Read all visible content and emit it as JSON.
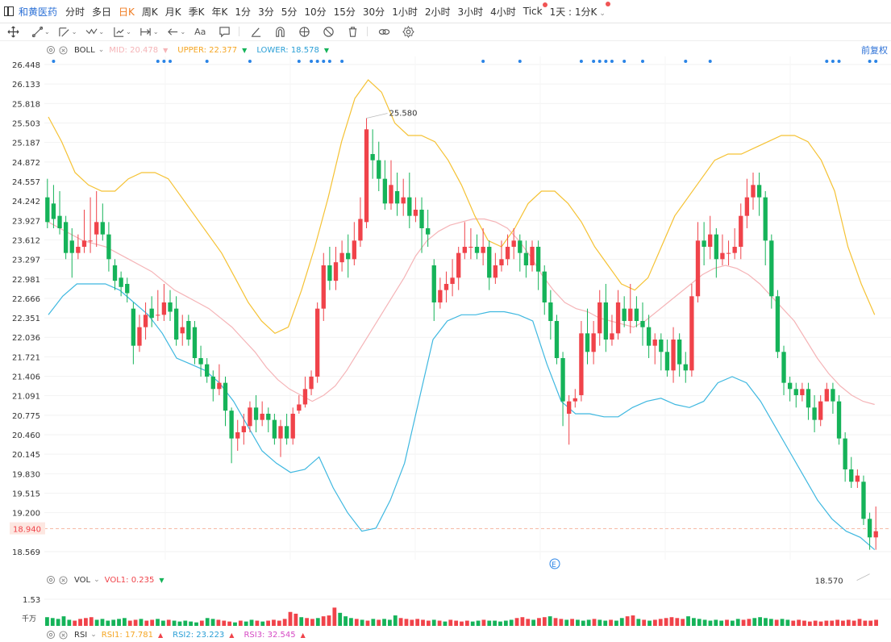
{
  "toolbar": {
    "stock_name": "和黄医药",
    "periods": [
      "分时",
      "多日",
      "日K",
      "周K",
      "月K",
      "季K",
      "年K",
      "1分",
      "3分",
      "5分",
      "10分",
      "15分",
      "30分",
      "1小时",
      "2小时",
      "3小时",
      "4小时",
      "Tick",
      "1天 : 1分K"
    ],
    "active_period": "日K"
  },
  "icons": [
    "move-icon",
    "line-icon",
    "channel-icon",
    "wave-icon",
    "measure-icon",
    "range-icon",
    "arrow-icon",
    "text-icon",
    "comment-icon",
    "pen-icon",
    "magnet-icon",
    "eye-icon",
    "hide-icon",
    "trash-icon",
    "link-icon",
    "gear-icon"
  ],
  "boll": {
    "name": "BOLL",
    "mid_label": "MID:",
    "mid": "20.478",
    "upper_label": "UPPER:",
    "upper": "22.377",
    "lower_label": "LOWER:",
    "lower": "18.578",
    "adjust": "前复权"
  },
  "vol": {
    "name": "VOL",
    "vol1_label": "VOL1:",
    "vol1": "0.235",
    "max": "1.53",
    "unit": "千万"
  },
  "rsi": {
    "name": "RSI",
    "rsi1_label": "RSI1:",
    "rsi1": "17.781",
    "rsi2_label": "RSI2:",
    "rsi2": "23.223",
    "rsi3_label": "RSI3:",
    "rsi3": "32.545"
  },
  "colors": {
    "up": "#f0434a",
    "down": "#15b359",
    "mid": "#f5b4b7",
    "upper": "#f5c234",
    "lower": "#3fb8e0",
    "accent": "#2a6fd6",
    "active": "#f07c22"
  },
  "chart_data": {
    "type": "candlestick",
    "y_ticks": [
      "26.448",
      "26.133",
      "25.818",
      "25.503",
      "25.187",
      "24.872",
      "24.557",
      "24.242",
      "23.927",
      "23.612",
      "23.297",
      "22.981",
      "22.666",
      "22.351",
      "22.036",
      "21.721",
      "21.406",
      "21.091",
      "20.775",
      "20.460",
      "20.145",
      "19.830",
      "19.515",
      "19.200",
      "18.569"
    ],
    "ylim": [
      18.569,
      26.448
    ],
    "current_price": "18.940",
    "high_label": "25.580",
    "low_label": "18.570",
    "candles": [
      [
        24.3,
        23.9,
        24.6,
        23.8
      ],
      [
        24.2,
        23.95,
        24.5,
        23.8
      ],
      [
        24.0,
        23.8,
        24.4,
        23.7
      ],
      [
        23.9,
        23.4,
        24.0,
        23.3
      ],
      [
        23.6,
        23.4,
        23.8,
        23.0
      ],
      [
        23.4,
        23.5,
        23.7,
        23.3
      ],
      [
        23.5,
        23.6,
        24.1,
        23.4
      ],
      [
        23.6,
        23.6,
        24.3,
        23.4
      ],
      [
        23.7,
        23.9,
        24.4,
        23.5
      ],
      [
        23.9,
        23.7,
        24.2,
        23.6
      ],
      [
        23.7,
        23.3,
        23.9,
        23.1
      ],
      [
        23.2,
        22.95,
        23.3,
        22.8
      ],
      [
        23.0,
        22.85,
        23.1,
        22.7
      ],
      [
        22.9,
        22.75,
        23.0,
        22.6
      ],
      [
        22.5,
        21.9,
        22.6,
        21.6
      ],
      [
        21.9,
        22.2,
        22.4,
        21.8
      ],
      [
        22.2,
        22.4,
        22.6,
        22.0
      ],
      [
        22.5,
        22.35,
        22.7,
        22.2
      ],
      [
        22.4,
        22.4,
        22.8,
        22.3
      ],
      [
        22.4,
        22.6,
        22.9,
        22.3
      ],
      [
        22.6,
        22.45,
        22.8,
        22.3
      ],
      [
        22.5,
        22.0,
        22.7,
        21.9
      ],
      [
        22.1,
        22.2,
        22.4,
        21.9
      ],
      [
        22.3,
        22.0,
        22.4,
        21.9
      ],
      [
        22.2,
        21.7,
        22.3,
        21.6
      ],
      [
        21.7,
        21.6,
        21.9,
        21.4
      ],
      [
        21.6,
        21.4,
        21.7,
        21.3
      ],
      [
        21.4,
        21.2,
        21.5,
        21.0
      ],
      [
        21.2,
        21.3,
        21.6,
        21.1
      ],
      [
        21.3,
        20.85,
        21.4,
        20.6
      ],
      [
        20.85,
        20.4,
        20.9,
        20.0
      ],
      [
        20.4,
        20.5,
        20.7,
        20.2
      ],
      [
        20.5,
        20.6,
        20.8,
        20.3
      ],
      [
        20.6,
        20.9,
        21.0,
        20.5
      ],
      [
        20.9,
        20.7,
        21.1,
        20.5
      ],
      [
        20.7,
        20.8,
        21.0,
        20.6
      ],
      [
        20.8,
        20.7,
        20.9,
        20.5
      ],
      [
        20.7,
        20.4,
        20.8,
        20.3
      ],
      [
        20.4,
        20.6,
        20.7,
        20.1
      ],
      [
        20.6,
        20.4,
        20.8,
        20.3
      ],
      [
        20.4,
        20.8,
        20.9,
        20.3
      ],
      [
        20.85,
        20.95,
        21.1,
        20.8
      ],
      [
        20.95,
        21.2,
        21.4,
        20.9
      ],
      [
        21.2,
        21.4,
        21.5,
        21.1
      ],
      [
        21.4,
        22.5,
        22.6,
        21.3
      ],
      [
        22.5,
        23.2,
        23.4,
        22.3
      ],
      [
        23.2,
        22.95,
        23.5,
        22.8
      ],
      [
        22.95,
        23.25,
        23.5,
        22.8
      ],
      [
        23.25,
        23.4,
        23.6,
        23.1
      ],
      [
        23.4,
        23.3,
        23.7,
        23.0
      ],
      [
        23.3,
        23.6,
        23.9,
        23.2
      ],
      [
        23.6,
        23.95,
        24.3,
        23.5
      ],
      [
        23.9,
        25.4,
        25.58,
        23.8
      ],
      [
        25.0,
        24.9,
        25.4,
        24.6
      ],
      [
        24.9,
        24.6,
        25.2,
        24.4
      ],
      [
        24.6,
        24.2,
        24.9,
        24.1
      ],
      [
        24.2,
        24.5,
        24.9,
        24.1
      ],
      [
        24.4,
        24.2,
        24.7,
        24.0
      ],
      [
        24.2,
        24.3,
        24.6,
        24.0
      ],
      [
        24.3,
        24.0,
        24.7,
        23.8
      ],
      [
        24.0,
        24.1,
        24.3,
        23.9
      ],
      [
        24.1,
        23.8,
        24.3,
        23.4
      ],
      [
        23.8,
        23.7,
        24.1,
        23.5
      ],
      [
        23.2,
        22.6,
        23.3,
        22.3
      ],
      [
        22.6,
        22.8,
        23.0,
        22.5
      ],
      [
        22.8,
        22.9,
        23.1,
        22.6
      ],
      [
        22.9,
        23.0,
        23.3,
        22.7
      ],
      [
        23.0,
        23.4,
        23.5,
        22.8
      ],
      [
        23.4,
        23.5,
        23.9,
        23.3
      ],
      [
        23.5,
        23.5,
        23.8,
        23.3
      ],
      [
        23.5,
        23.4,
        23.7,
        23.3
      ],
      [
        23.4,
        23.5,
        23.8,
        23.2
      ],
      [
        23.5,
        23.0,
        23.6,
        22.8
      ],
      [
        23.0,
        23.2,
        23.4,
        22.9
      ],
      [
        23.2,
        23.3,
        23.6,
        23.1
      ],
      [
        23.3,
        23.5,
        23.7,
        23.2
      ],
      [
        23.5,
        23.6,
        23.8,
        23.3
      ],
      [
        23.6,
        23.4,
        23.7,
        23.1
      ],
      [
        23.4,
        23.2,
        23.6,
        23.0
      ],
      [
        23.2,
        23.5,
        23.6,
        23.1
      ],
      [
        23.5,
        23.1,
        23.6,
        22.8
      ],
      [
        23.1,
        22.6,
        23.2,
        22.4
      ],
      [
        22.6,
        22.3,
        22.8,
        22.0
      ],
      [
        22.3,
        21.7,
        22.4,
        21.6
      ],
      [
        21.7,
        21.0,
        21.8,
        20.6
      ],
      [
        20.8,
        21.0,
        21.1,
        20.3
      ],
      [
        21.0,
        21.05,
        21.2,
        20.9
      ],
      [
        21.1,
        22.1,
        22.3,
        21.0
      ],
      [
        22.1,
        21.8,
        22.5,
        21.6
      ],
      [
        21.8,
        22.1,
        22.3,
        21.6
      ],
      [
        22.1,
        22.6,
        22.8,
        21.9
      ],
      [
        22.6,
        22.0,
        22.9,
        21.8
      ],
      [
        22.0,
        22.1,
        22.4,
        21.9
      ],
      [
        22.1,
        22.6,
        22.8,
        22.0
      ],
      [
        22.5,
        22.3,
        22.7,
        22.2
      ],
      [
        22.3,
        22.5,
        22.9,
        22.1
      ],
      [
        22.5,
        22.3,
        22.7,
        22.2
      ],
      [
        22.3,
        22.2,
        22.6,
        21.9
      ],
      [
        22.2,
        21.9,
        22.4,
        21.7
      ],
      [
        21.9,
        22.0,
        22.1,
        21.6
      ],
      [
        22.0,
        21.8,
        22.1,
        21.5
      ],
      [
        21.8,
        21.5,
        22.0,
        21.4
      ],
      [
        21.5,
        22.0,
        22.2,
        21.3
      ],
      [
        22.0,
        21.6,
        22.1,
        21.4
      ],
      [
        21.6,
        21.5,
        21.8,
        21.3
      ],
      [
        21.5,
        22.7,
        22.9,
        21.4
      ],
      [
        22.7,
        23.6,
        23.9,
        22.6
      ],
      [
        23.6,
        23.5,
        23.9,
        23.2
      ],
      [
        23.5,
        23.7,
        24.0,
        23.3
      ],
      [
        23.7,
        23.3,
        23.8,
        23.0
      ],
      [
        23.3,
        23.4,
        23.7,
        23.2
      ],
      [
        23.4,
        23.4,
        23.6,
        23.2
      ],
      [
        23.4,
        23.5,
        23.8,
        23.3
      ],
      [
        23.5,
        24.0,
        24.2,
        23.3
      ],
      [
        24.0,
        24.3,
        24.6,
        23.8
      ],
      [
        24.3,
        24.5,
        24.7,
        24.1
      ],
      [
        24.5,
        24.3,
        24.7,
        24.0
      ],
      [
        24.3,
        23.6,
        24.4,
        23.2
      ],
      [
        23.6,
        22.7,
        23.7,
        22.5
      ],
      [
        22.7,
        21.8,
        22.8,
        21.7
      ],
      [
        21.8,
        21.3,
        21.9,
        21.1
      ],
      [
        21.3,
        21.2,
        21.4,
        21.0
      ],
      [
        21.2,
        21.1,
        21.3,
        20.9
      ],
      [
        21.1,
        21.2,
        21.3,
        21.0
      ],
      [
        21.2,
        20.9,
        21.3,
        20.7
      ],
      [
        20.9,
        20.7,
        21.1,
        20.5
      ],
      [
        20.7,
        21.0,
        21.1,
        20.6
      ],
      [
        21.0,
        21.2,
        21.3,
        21.0
      ],
      [
        21.2,
        21.0,
        21.3,
        20.8
      ],
      [
        21.0,
        20.4,
        21.1,
        20.3
      ],
      [
        20.4,
        19.9,
        20.5,
        19.7
      ],
      [
        19.9,
        19.7,
        20.1,
        19.6
      ],
      [
        19.7,
        19.8,
        19.9,
        19.6
      ],
      [
        19.7,
        19.1,
        19.8,
        19.0
      ],
      [
        19.1,
        18.8,
        19.2,
        18.6
      ],
      [
        18.8,
        18.9,
        19.3,
        18.6
      ]
    ],
    "mid": [
      23.9,
      23.8,
      23.7,
      23.6,
      23.55,
      23.5,
      23.4,
      23.3,
      23.2,
      23.1,
      22.95,
      22.8,
      22.7,
      22.6,
      22.5,
      22.35,
      22.2,
      22.0,
      21.8,
      21.55,
      21.35,
      21.2,
      21.1,
      21.0,
      21.1,
      21.25,
      21.5,
      21.8,
      22.1,
      22.4,
      22.7,
      23.0,
      23.35,
      23.6,
      23.75,
      23.85,
      23.9,
      23.95,
      23.95,
      23.9,
      23.8,
      23.6,
      23.35,
      23.05,
      22.8,
      22.6,
      22.5,
      22.45,
      22.35,
      22.3,
      22.25,
      22.2,
      22.3,
      22.45,
      22.6,
      22.75,
      22.9,
      23.05,
      23.15,
      23.2,
      23.15,
      23.05,
      22.9,
      22.7,
      22.5,
      22.3,
      22.0,
      21.7,
      21.45,
      21.25,
      21.1,
      21.0,
      20.95
    ],
    "upper": [
      25.6,
      25.2,
      24.7,
      24.5,
      24.4,
      24.4,
      24.6,
      24.7,
      24.7,
      24.6,
      24.3,
      24.0,
      23.7,
      23.4,
      23.0,
      22.6,
      22.3,
      22.1,
      22.2,
      22.8,
      23.5,
      24.3,
      25.2,
      25.9,
      26.2,
      26.0,
      25.5,
      25.3,
      25.3,
      25.2,
      24.9,
      24.5,
      24.0,
      23.6,
      23.5,
      23.8,
      24.2,
      24.4,
      24.4,
      24.2,
      23.9,
      23.5,
      23.2,
      22.9,
      22.8,
      23.0,
      23.5,
      24.0,
      24.3,
      24.6,
      24.9,
      25.0,
      25.0,
      25.1,
      25.2,
      25.3,
      25.3,
      25.2,
      24.9,
      24.4,
      23.5,
      22.9,
      22.4
    ],
    "lower": [
      22.4,
      22.7,
      22.9,
      22.9,
      22.9,
      22.8,
      22.6,
      22.4,
      22.1,
      21.7,
      21.6,
      21.5,
      21.3,
      21.0,
      20.6,
      20.2,
      20.0,
      19.85,
      19.9,
      20.1,
      19.6,
      19.2,
      18.9,
      18.95,
      19.4,
      20.0,
      21.0,
      22.0,
      22.3,
      22.4,
      22.4,
      22.45,
      22.45,
      22.4,
      22.3,
      21.6,
      21.0,
      20.8,
      20.8,
      20.75,
      20.75,
      20.9,
      21.0,
      21.05,
      20.95,
      20.9,
      21.0,
      21.3,
      21.4,
      21.3,
      21.0,
      20.6,
      20.2,
      19.8,
      19.4,
      19.1,
      18.9,
      18.8,
      18.6
    ],
    "volume_max": "1.53",
    "volume": [
      0.5,
      0.45,
      0.4,
      0.55,
      0.35,
      0.3,
      0.4,
      0.45,
      0.5,
      0.35,
      0.4,
      0.3,
      0.35,
      0.4,
      0.45,
      0.3,
      0.35,
      0.4,
      0.3,
      0.35,
      0.4,
      0.3,
      0.35,
      0.3,
      0.25,
      0.3,
      0.25,
      0.2,
      0.3,
      0.45,
      0.4,
      0.35,
      0.3,
      0.25,
      0.2,
      0.3,
      0.25,
      0.35,
      0.3,
      0.25,
      0.3,
      0.35,
      0.3,
      0.4,
      0.8,
      0.7,
      0.5,
      0.45,
      0.4,
      0.45,
      0.55,
      0.6,
      1.05,
      0.75,
      0.55,
      0.45,
      0.4,
      0.35,
      0.3,
      0.4,
      0.35,
      0.4,
      0.35,
      0.6,
      0.45,
      0.4,
      0.35,
      0.4,
      0.35,
      0.3,
      0.35,
      0.3,
      0.25,
      0.35,
      0.3,
      0.25,
      0.3,
      0.25,
      0.3,
      0.35,
      0.3,
      0.3,
      0.25,
      0.3,
      0.35,
      0.45,
      0.5,
      0.4,
      0.35,
      0.45,
      0.5,
      0.55,
      0.45,
      0.4,
      0.35,
      0.4,
      0.35,
      0.3,
      0.35,
      0.4,
      0.35,
      0.3,
      0.35,
      0.3,
      0.45,
      0.55,
      0.6,
      0.4,
      0.35,
      0.3,
      0.35,
      0.4,
      0.45,
      0.5,
      0.45,
      0.4,
      0.55,
      0.45,
      0.4,
      0.35,
      0.3,
      0.35,
      0.3,
      0.35,
      0.3,
      0.4,
      0.35,
      0.4,
      0.45,
      0.5,
      0.45,
      0.4,
      0.35,
      0.4,
      0.35,
      0.3,
      0.35,
      0.3,
      0.25,
      0.3,
      0.25,
      0.3,
      0.3,
      0.35,
      0.3,
      0.35,
      0.3,
      0.4,
      0.3,
      0.3,
      0.35
    ]
  }
}
